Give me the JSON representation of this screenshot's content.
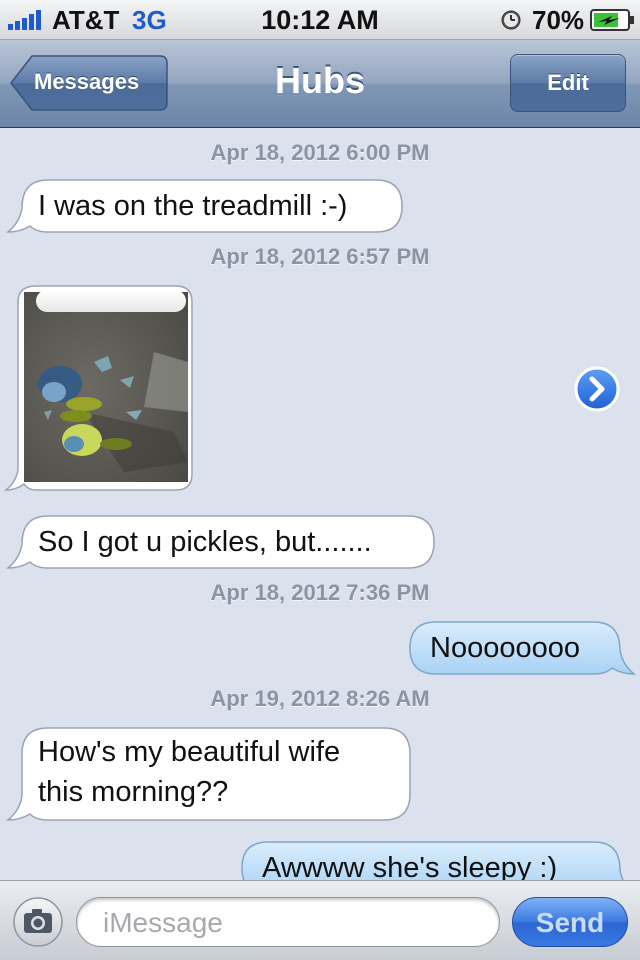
{
  "status_bar": {
    "carrier": "AT&T",
    "network": "3G",
    "time": "10:12 AM",
    "battery_percent": "70%",
    "icons": [
      "signal-bars-icon",
      "alarm-clock-icon",
      "battery-charging-icon"
    ]
  },
  "nav": {
    "back_label": "Messages",
    "title": "Hubs",
    "edit_label": "Edit"
  },
  "thread": {
    "timestamps": [
      "Apr 18, 2012 6:00 PM",
      "Apr 18, 2012 6:57 PM",
      "Apr 18, 2012 7:36 PM",
      "Apr 19, 2012 8:26 AM"
    ],
    "messages": [
      {
        "from": "them",
        "text": "I was on the treadmill :-)"
      },
      {
        "from": "them",
        "kind": "photo"
      },
      {
        "from": "them",
        "text": "So I got u pickles, but......."
      },
      {
        "from": "me",
        "text": "Noooooooo"
      },
      {
        "from": "them",
        "lines": [
          "How's my beautiful wife",
          "this morning??"
        ]
      },
      {
        "from": "me",
        "text": "Awwww she's sleepy :)"
      }
    ]
  },
  "input": {
    "placeholder": "iMessage",
    "send_label": "Send"
  },
  "colors": {
    "incoming_bubble": "#ffffff",
    "outgoing_bubble": "#bcdcf7",
    "background": "#dbe2ed",
    "navbar": "#6d86a8",
    "send_button": "#3a78e2"
  }
}
